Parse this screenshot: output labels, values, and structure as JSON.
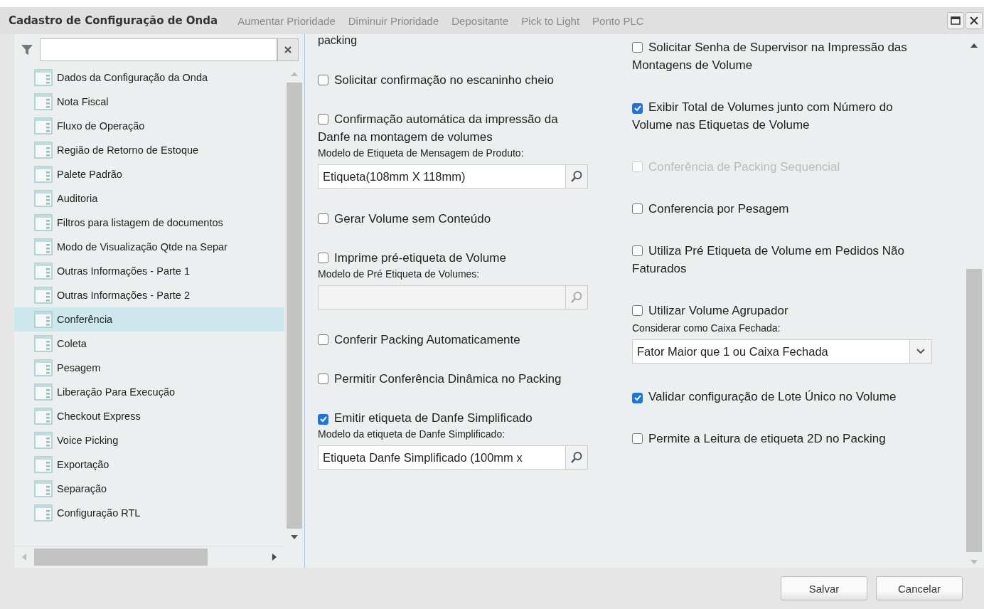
{
  "background_toolbar": [
    "Aumentar Prioridade",
    "Diminuir Prioridade",
    "Depositante",
    "Pick to Light",
    "Ponto PLC"
  ],
  "window": {
    "title": "Cadastro de Configuração de Onda"
  },
  "sidebar": {
    "items": [
      {
        "label": "Dados da Configuração da Onda",
        "selected": false
      },
      {
        "label": "Nota Fiscal",
        "selected": false
      },
      {
        "label": "Fluxo de Operação",
        "selected": false
      },
      {
        "label": "Região de Retorno de Estoque",
        "selected": false
      },
      {
        "label": "Palete Padrão",
        "selected": false
      },
      {
        "label": "Auditoria",
        "selected": false
      },
      {
        "label": "Filtros para listagem de documentos",
        "selected": false
      },
      {
        "label": "Modo de Visualização Qtde na Separ",
        "selected": false
      },
      {
        "label": "Outras Informações - Parte 1",
        "selected": false
      },
      {
        "label": "Outras Informações - Parte 2",
        "selected": false
      },
      {
        "label": "Conferência",
        "selected": true
      },
      {
        "label": "Coleta",
        "selected": false
      },
      {
        "label": "Pesagem",
        "selected": false
      },
      {
        "label": "Liberação Para Execução",
        "selected": false
      },
      {
        "label": "Checkout Express",
        "selected": false
      },
      {
        "label": "Voice Picking",
        "selected": false
      },
      {
        "label": "Exportação",
        "selected": false
      },
      {
        "label": "Separação",
        "selected": false
      },
      {
        "label": "Configuração RTL",
        "selected": false
      }
    ]
  },
  "columns": [
    [
      {
        "kind": "text",
        "label": "packing"
      },
      {
        "kind": "checkbox",
        "label": "Solicitar confirmação no escaninho cheio",
        "checked": false,
        "disabled": false
      },
      {
        "kind": "checkbox",
        "label": "Confirmação automática da impressão da Danfe na montagem de volumes",
        "checked": false,
        "disabled": false
      },
      {
        "kind": "lookup",
        "label": "Modelo de Etiqueta de Mensagem de Produto:",
        "value": "Etiqueta(108mm X 118mm)",
        "disabled": false
      },
      {
        "kind": "checkbox",
        "label": "Gerar Volume sem Conteúdo",
        "checked": false,
        "disabled": false
      },
      {
        "kind": "checkbox",
        "label": "Imprime pré-etiqueta de Volume",
        "checked": false,
        "disabled": false
      },
      {
        "kind": "lookup",
        "label": "Modelo de Pré Etiqueta de Volumes:",
        "disabled": true
      },
      {
        "kind": "checkbox",
        "label": "Conferir Packing Automaticamente",
        "checked": false,
        "disabled": false
      },
      {
        "kind": "checkbox",
        "label": "Permitir Conferência Dinâmica no Packing",
        "checked": false,
        "disabled": false
      },
      {
        "kind": "checkbox",
        "label": "Emitir etiqueta de Danfe Simplificado",
        "checked": true,
        "disabled": false
      },
      {
        "kind": "lookup",
        "label": "Modelo da etiqueta de Danfe Simplificado:",
        "value": "Etiqueta Danfe Simplificado (100mm x",
        "disabled": false
      }
    ],
    [
      {
        "kind": "checkbox",
        "label": "Solicitar Senha de Supervisor na Impressão das Montagens de Volume",
        "checked": false,
        "disabled": false
      },
      {
        "kind": "checkbox",
        "label": "Exibir Total de Volumes junto com Número do Volume nas Etiquetas de Volume",
        "checked": true,
        "disabled": false
      },
      {
        "kind": "checkbox",
        "label": "Conferência de Packing Sequencial",
        "checked": false,
        "disabled": true
      },
      {
        "kind": "checkbox",
        "label": "Conferencia por Pesagem",
        "checked": false,
        "disabled": false
      },
      {
        "kind": "checkbox",
        "label": "Utiliza Pré Etiqueta de Volume em Pedidos Não Faturados",
        "checked": false,
        "disabled": false
      },
      {
        "kind": "checkbox",
        "label": "Utilizar Volume Agrupador",
        "checked": false,
        "disabled": false
      },
      {
        "kind": "select",
        "label": "Considerar como Caixa Fechada:",
        "value": "Fator Maior que 1 ou Caixa Fechada",
        "disabled": false
      },
      {
        "kind": "checkbox",
        "label": "Validar configuração de Lote Único no Volume",
        "checked": true,
        "disabled": false
      },
      {
        "kind": "checkbox",
        "label": "Permite a Leitura de etiqueta 2D no Packing",
        "checked": false,
        "disabled": false
      }
    ]
  ],
  "buttons": [
    "Salvar",
    "Cancelar"
  ]
}
